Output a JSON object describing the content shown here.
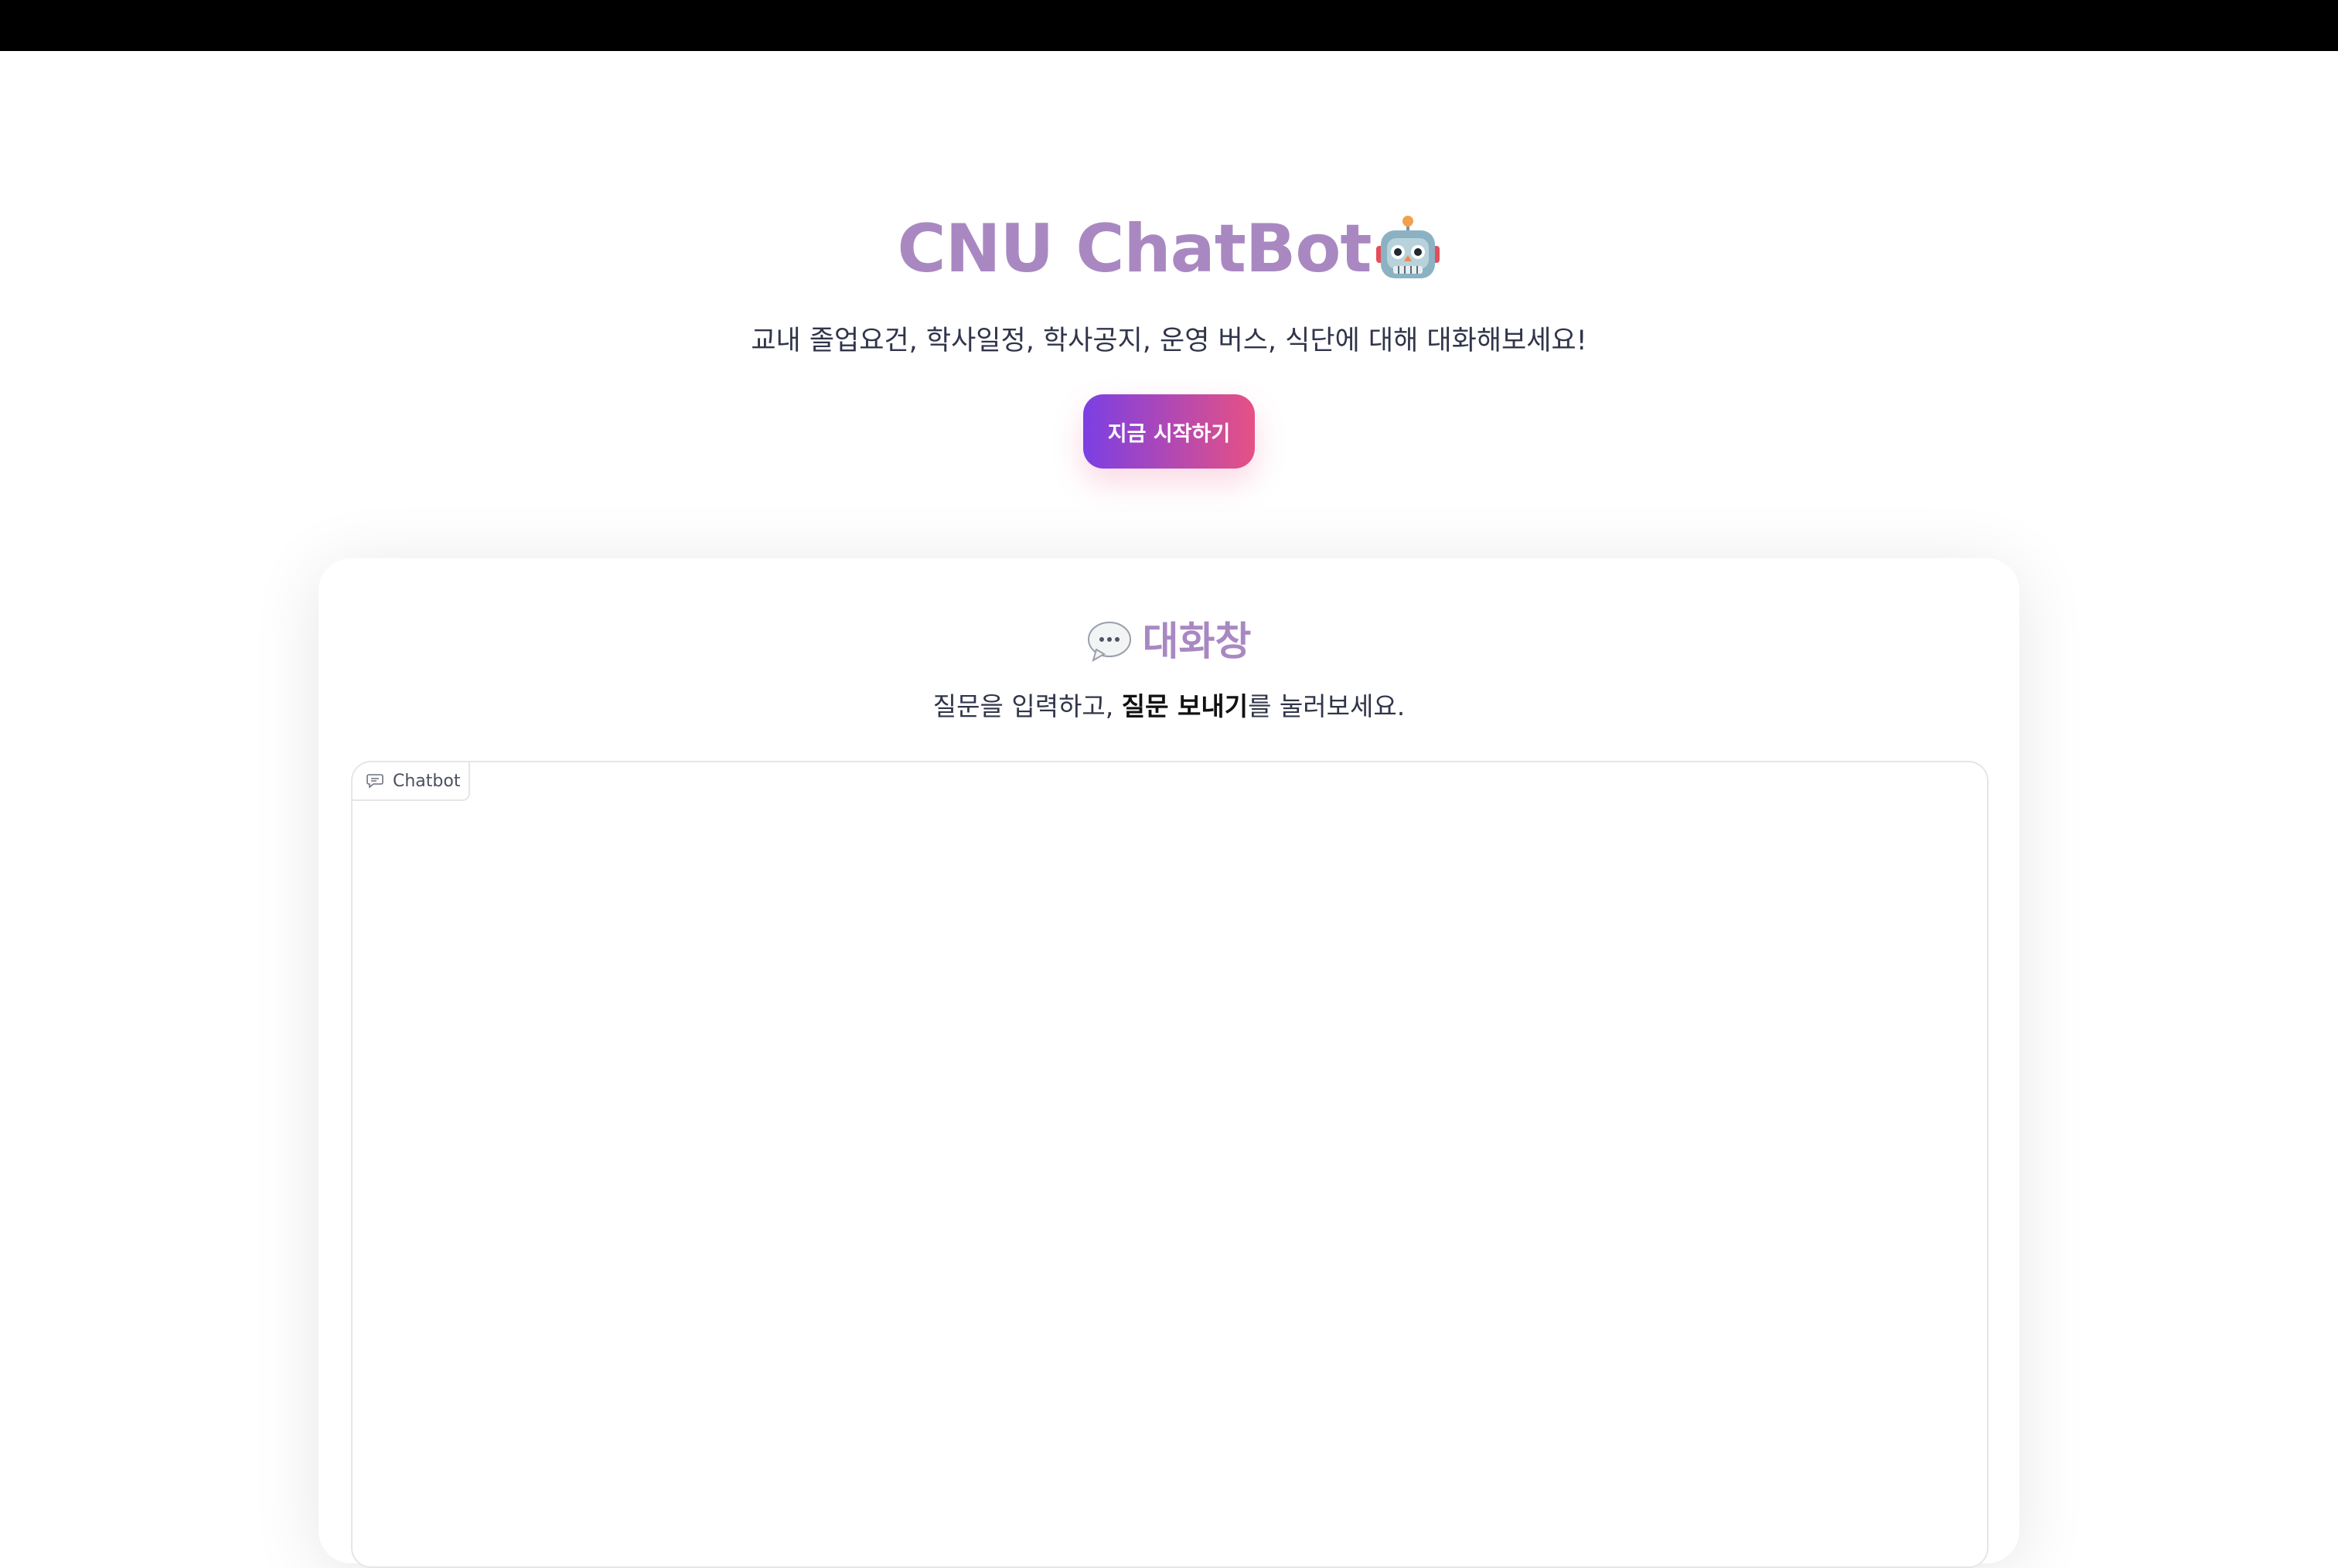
{
  "header": {
    "title": "CNU ChatBot",
    "title_icon": "robot-icon",
    "subtitle": "교내 졸업요건, 학사일정, 학사공지, 운영 버스, 식단에 대해 대화해보세요!",
    "cta_label": "지금 시작하기"
  },
  "chat_panel": {
    "title_icon": "speech-bubble-icon",
    "title": "대화창",
    "instructions_prefix": "질문을 입력하고, ",
    "instructions_bold": "질문 보내기",
    "instructions_suffix": "를 눌러보세요.",
    "chatbot_label": "Chatbot",
    "chatbot_label_icon": "chat-icon"
  },
  "colors": {
    "accent_purple": "#a988c2",
    "cta_gradient_start": "#7b3fe4",
    "cta_gradient_end": "#e65184",
    "text_dark": "#30354a",
    "top_bar": "#000000"
  }
}
